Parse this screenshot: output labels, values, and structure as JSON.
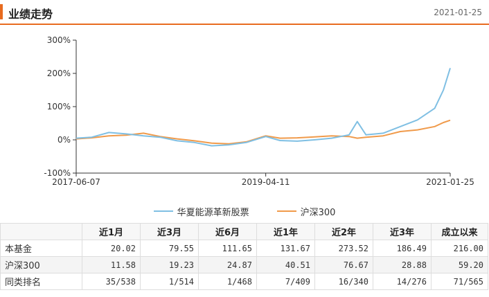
{
  "header": {
    "title": "业绩走势",
    "date": "2021-01-25"
  },
  "colors": {
    "accent": "#e86b1f",
    "fund": "#7fbfe3",
    "index": "#f09a4a"
  },
  "chart_data": {
    "type": "line",
    "x_range": [
      "2017-06-07",
      "2021-01-25"
    ],
    "x_ticks": [
      "2017-06-07",
      "2019-04-11",
      "2021-01-25"
    ],
    "ylim": [
      -100,
      300
    ],
    "y_ticks": [
      "300%",
      "200%",
      "100%",
      "0%",
      "-100%"
    ],
    "y_tick_values": [
      300,
      200,
      100,
      0,
      -100
    ],
    "grid": false,
    "legend": "bottom",
    "series": [
      {
        "name": "华夏能源革新股票",
        "x": [
          "2017-06-07",
          "2017-08-01",
          "2017-10-01",
          "2017-12-01",
          "2018-02-01",
          "2018-04-01",
          "2018-06-01",
          "2018-08-01",
          "2018-10-01",
          "2018-12-01",
          "2019-02-01",
          "2019-04-11",
          "2019-06-01",
          "2019-08-01",
          "2019-10-01",
          "2019-12-01",
          "2020-02-01",
          "2020-03-01",
          "2020-04-01",
          "2020-06-01",
          "2020-08-01",
          "2020-10-01",
          "2020-12-01",
          "2021-01-01",
          "2021-01-25"
        ],
        "values": [
          5,
          8,
          22,
          18,
          12,
          8,
          -3,
          -8,
          -18,
          -15,
          -8,
          10,
          -2,
          -4,
          0,
          5,
          15,
          55,
          15,
          20,
          40,
          60,
          95,
          150,
          216
        ]
      },
      {
        "name": "沪深300",
        "x": [
          "2017-06-07",
          "2017-08-01",
          "2017-10-01",
          "2017-12-01",
          "2018-02-01",
          "2018-04-01",
          "2018-06-01",
          "2018-08-01",
          "2018-10-01",
          "2018-12-01",
          "2019-02-01",
          "2019-04-11",
          "2019-06-01",
          "2019-08-01",
          "2019-10-01",
          "2019-12-01",
          "2020-02-01",
          "2020-03-01",
          "2020-04-01",
          "2020-06-01",
          "2020-08-01",
          "2020-10-01",
          "2020-12-01",
          "2021-01-01",
          "2021-01-25"
        ],
        "values": [
          3,
          6,
          12,
          14,
          20,
          10,
          3,
          -3,
          -10,
          -12,
          -6,
          12,
          5,
          6,
          9,
          12,
          10,
          5,
          8,
          12,
          25,
          30,
          40,
          52,
          59
        ]
      }
    ]
  },
  "table": {
    "headers": [
      "",
      "近1月",
      "近3月",
      "近6月",
      "近1年",
      "近2年",
      "近3年",
      "成立以来"
    ],
    "rows": [
      [
        "本基金",
        "20.02",
        "79.55",
        "111.65",
        "131.67",
        "273.52",
        "186.49",
        "216.00"
      ],
      [
        "沪深300",
        "11.58",
        "19.23",
        "24.87",
        "40.51",
        "76.67",
        "28.88",
        "59.20"
      ],
      [
        "同类排名",
        "35/538",
        "1/514",
        "1/468",
        "7/409",
        "16/340",
        "14/276",
        "71/565"
      ]
    ]
  }
}
